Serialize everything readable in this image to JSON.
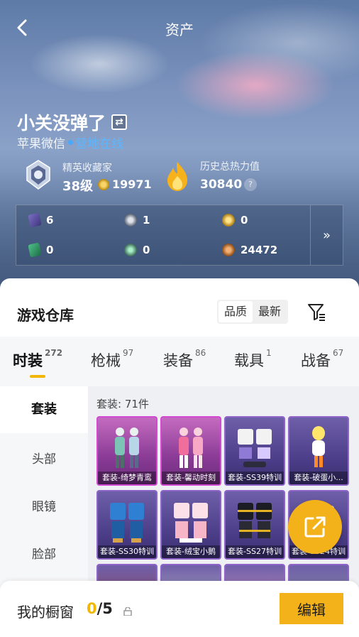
{
  "header": {
    "title": "资产"
  },
  "profile": {
    "name": "小关没弹了",
    "platform": "苹果微信",
    "status": "营地在线",
    "rank_title": "精英收藏家",
    "rank_level": "38级",
    "coins": "19971",
    "heat_title": "历史总热力值",
    "heat_value": "30840",
    "heat_help": "?"
  },
  "stats": [
    {
      "icon": "purple-card-icon",
      "value": "6"
    },
    {
      "icon": "silver-medal-icon",
      "value": "1"
    },
    {
      "icon": "gold-medal-icon",
      "value": "0"
    },
    {
      "icon": "green-card-icon",
      "value": "0"
    },
    {
      "icon": "green-orb-icon",
      "value": "0"
    },
    {
      "icon": "bronze-coin-icon",
      "value": "24472"
    }
  ],
  "warehouse": {
    "title": "游戏仓库",
    "sort_quality": "品质",
    "sort_latest": "最新"
  },
  "tabs": [
    {
      "label": "时装",
      "count": "272"
    },
    {
      "label": "枪械",
      "count": "97"
    },
    {
      "label": "装备",
      "count": "86"
    },
    {
      "label": "载具",
      "count": "1"
    },
    {
      "label": "战备",
      "count": "67"
    }
  ],
  "side_menu": [
    "套装",
    "头部",
    "眼镜",
    "脸部"
  ],
  "grid": {
    "count_label": "套装: 71件",
    "items": [
      {
        "label": "套装-绮梦青鸾"
      },
      {
        "label": "套装-馨动时刻"
      },
      {
        "label": "套装-SS39特训"
      },
      {
        "label": "套装-破蛋小..."
      },
      {
        "label": "套装-SS30特训"
      },
      {
        "label": "套装-绒宝小鹅"
      },
      {
        "label": "套装-SS27特训"
      },
      {
        "label": "套装-SS24特训"
      }
    ]
  },
  "showcase": {
    "label": "我的橱窗",
    "current": "0",
    "total": "/5",
    "edit_label": "编辑"
  },
  "colors": {
    "accent": "#f4b21a",
    "online": "#5bb6ff"
  }
}
